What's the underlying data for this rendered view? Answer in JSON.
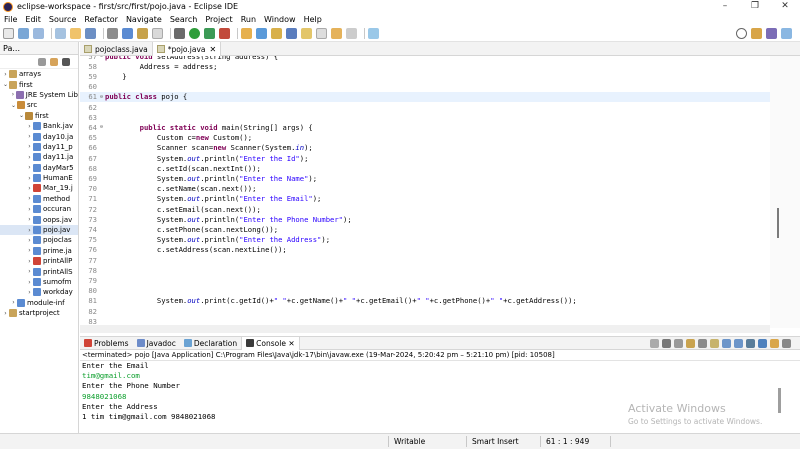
{
  "window": {
    "title": "eclipse-workspace - first/src/first/pojo.java - Eclipse IDE",
    "controls": [
      "–",
      "❐",
      "✕"
    ]
  },
  "menu": [
    "File",
    "Edit",
    "Source",
    "Refactor",
    "Navigate",
    "Search",
    "Project",
    "Run",
    "Window",
    "Help"
  ],
  "explorer": {
    "title": "Pa...",
    "tree": [
      {
        "indent": 0,
        "twisty": "›",
        "icon": "project",
        "label": "arrays",
        "selected": false
      },
      {
        "indent": 0,
        "twisty": "⌄",
        "icon": "project",
        "label": "first",
        "selected": false
      },
      {
        "indent": 1,
        "twisty": "›",
        "icon": "library",
        "label": "JRE System Lib",
        "selected": false
      },
      {
        "indent": 1,
        "twisty": "⌄",
        "icon": "source-folder",
        "label": "src",
        "selected": false
      },
      {
        "indent": 2,
        "twisty": "⌄",
        "icon": "package",
        "label": "first",
        "selected": false
      },
      {
        "indent": 3,
        "twisty": "›",
        "icon": "java-file",
        "label": "Bank.jav",
        "selected": false
      },
      {
        "indent": 3,
        "twisty": "›",
        "icon": "java-file",
        "label": "day10.ja",
        "selected": false
      },
      {
        "indent": 3,
        "twisty": "›",
        "icon": "java-file",
        "label": "day11_p",
        "selected": false
      },
      {
        "indent": 3,
        "twisty": "›",
        "icon": "java-file",
        "label": "day11.ja",
        "selected": false
      },
      {
        "indent": 3,
        "twisty": "›",
        "icon": "java-file",
        "label": "dayMar5",
        "selected": false
      },
      {
        "indent": 3,
        "twisty": "›",
        "icon": "java-file",
        "label": "HumanE",
        "selected": false
      },
      {
        "indent": 3,
        "twisty": "›",
        "icon": "java-file-error",
        "label": "Mar_19.j",
        "selected": false
      },
      {
        "indent": 3,
        "twisty": "›",
        "icon": "java-file",
        "label": "method",
        "selected": false
      },
      {
        "indent": 3,
        "twisty": "›",
        "icon": "java-file",
        "label": "occuran",
        "selected": false
      },
      {
        "indent": 3,
        "twisty": "›",
        "icon": "java-file",
        "label": "oops.jav",
        "selected": false
      },
      {
        "indent": 3,
        "twisty": "›",
        "icon": "java-file",
        "label": "pojo.jav",
        "selected": true
      },
      {
        "indent": 3,
        "twisty": "›",
        "icon": "java-file",
        "label": "pojoclas",
        "selected": false
      },
      {
        "indent": 3,
        "twisty": "›",
        "icon": "java-file",
        "label": "prime.ja",
        "selected": false
      },
      {
        "indent": 3,
        "twisty": "›",
        "icon": "java-file-error",
        "label": "printAllP",
        "selected": false
      },
      {
        "indent": 3,
        "twisty": "›",
        "icon": "java-file",
        "label": "printAllS",
        "selected": false
      },
      {
        "indent": 3,
        "twisty": "›",
        "icon": "java-file",
        "label": "sumofm",
        "selected": false
      },
      {
        "indent": 3,
        "twisty": "›",
        "icon": "java-file",
        "label": "workday",
        "selected": false
      },
      {
        "indent": 1,
        "twisty": "›",
        "icon": "module-file",
        "label": "module-inf",
        "selected": false
      },
      {
        "indent": 0,
        "twisty": "›",
        "icon": "project",
        "label": "startproject",
        "selected": false
      }
    ]
  },
  "editor_tabs": [
    {
      "label": "pojoclass.java",
      "active": false,
      "close": ""
    },
    {
      "label": "*pojo.java",
      "active": true,
      "close": "✕"
    }
  ],
  "code_lines": [
    {
      "num": "57",
      "fold": "⊖",
      "text": "public void setAddress(String address) {",
      "current": false
    },
    {
      "num": "58",
      "fold": "",
      "text": "        Address = address;",
      "current": false
    },
    {
      "num": "59",
      "fold": "",
      "text": "    }",
      "current": false
    },
    {
      "num": "60",
      "fold": "",
      "text": "",
      "current": false
    },
    {
      "num": "61",
      "fold": "⊖",
      "text": "public class pojo {",
      "current": true
    },
    {
      "num": "62",
      "fold": "",
      "text": "",
      "current": false
    },
    {
      "num": "63",
      "fold": "",
      "text": "",
      "current": false
    },
    {
      "num": "64",
      "fold": "⊖",
      "text": "        public static void main(String[] args) {",
      "current": false
    },
    {
      "num": "65",
      "fold": "",
      "text": "            Custom c=new Custom();",
      "current": false
    },
    {
      "num": "66",
      "fold": "",
      "text": "            Scanner scan=new Scanner(System.in);",
      "current": false
    },
    {
      "num": "67",
      "fold": "",
      "text": "            System.out.println(\"Enter the Id\");",
      "current": false
    },
    {
      "num": "68",
      "fold": "",
      "text": "            c.setId(scan.nextInt());",
      "current": false
    },
    {
      "num": "69",
      "fold": "",
      "text": "            System.out.println(\"Enter the Name\");",
      "current": false
    },
    {
      "num": "70",
      "fold": "",
      "text": "            c.setName(scan.next());",
      "current": false
    },
    {
      "num": "71",
      "fold": "",
      "text": "            System.out.println(\"Enter the Email\");",
      "current": false
    },
    {
      "num": "72",
      "fold": "",
      "text": "            c.setEmail(scan.next());",
      "current": false
    },
    {
      "num": "73",
      "fold": "",
      "text": "            System.out.println(\"Enter the Phone Number\");",
      "current": false
    },
    {
      "num": "74",
      "fold": "",
      "text": "            c.setPhone(scan.nextLong());",
      "current": false
    },
    {
      "num": "75",
      "fold": "",
      "text": "            System.out.println(\"Enter the Address\");",
      "current": false
    },
    {
      "num": "76",
      "fold": "",
      "text": "            c.setAddress(scan.nextLine());",
      "current": false
    },
    {
      "num": "77",
      "fold": "",
      "text": "",
      "current": false
    },
    {
      "num": "78",
      "fold": "",
      "text": "",
      "current": false
    },
    {
      "num": "79",
      "fold": "",
      "text": "",
      "current": false
    },
    {
      "num": "80",
      "fold": "",
      "text": "",
      "current": false
    },
    {
      "num": "81",
      "fold": "",
      "text": "            System.out.print(c.getId()+\" \"+c.getName()+\" \"+c.getEmail()+\" \"+c.getPhone()+\" \"+c.getAddress());",
      "current": false
    },
    {
      "num": "82",
      "fold": "",
      "text": "",
      "current": false
    },
    {
      "num": "83",
      "fold": "",
      "text": "",
      "current": false
    }
  ],
  "console_tabs": [
    {
      "label": "Problems",
      "icon": "problems",
      "active": false
    },
    {
      "label": "Javadoc",
      "icon": "javadoc",
      "active": false
    },
    {
      "label": "Declaration",
      "icon": "declaration",
      "active": false
    },
    {
      "label": "Console ✕",
      "icon": "console",
      "active": true
    }
  ],
  "console": {
    "description": "<terminated> pojo [Java Application] C:\\Program Files\\Java\\jdk-17\\bin\\javaw.exe  (19-Mar-2024, 5:20:42 pm – 5:21:10 pm) [pid: 10508]",
    "lines": [
      {
        "text": "Enter the Email",
        "input": false
      },
      {
        "text": "tim@gmail.com",
        "input": true
      },
      {
        "text": "Enter the Phone Number",
        "input": false
      },
      {
        "text": "9848021068",
        "input": true
      },
      {
        "text": "Enter the Address",
        "input": false
      },
      {
        "text": "1 tim tim@gmail.com 9848021068",
        "input": false
      }
    ]
  },
  "watermark": {
    "title": "Activate Windows",
    "subtitle": "Go to Settings to activate Windows."
  },
  "status": {
    "mode": "Writable",
    "insert": "Smart Insert",
    "position": "61 : 1 : 949"
  },
  "colors": {
    "keyword": "#7f0055",
    "string": "#2a00ff",
    "field": "#0000c0",
    "console_input": "#0b9e2b",
    "current_line": "#e8f2fe",
    "selection": "#dbe6f5"
  }
}
